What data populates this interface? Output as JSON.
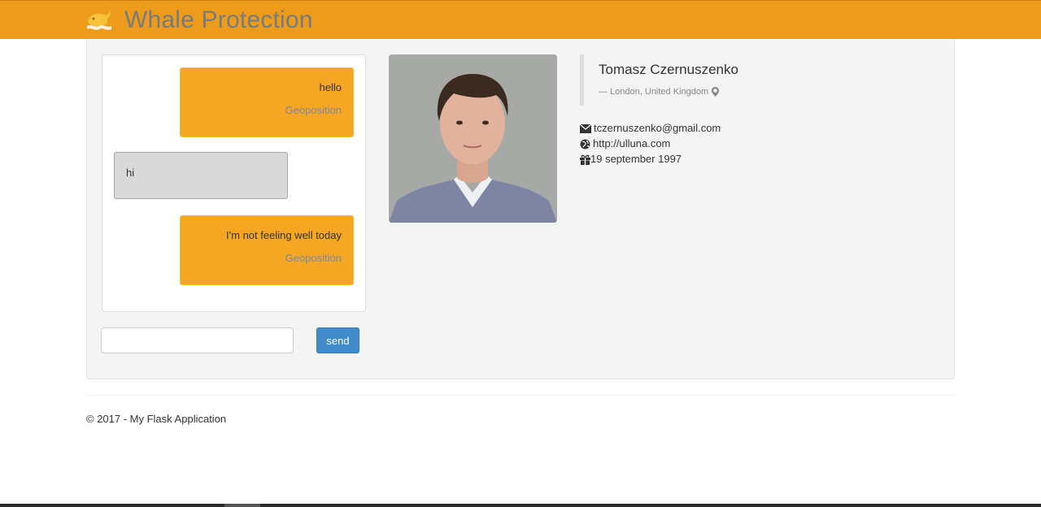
{
  "header": {
    "title": "Whale Protection",
    "logo_icon": "whale-logo-icon",
    "background": "#ec9c1a"
  },
  "chat": {
    "messages": [
      {
        "sender": "me",
        "text": "hello",
        "link": "Geoposition"
      },
      {
        "sender": "other",
        "text": "hi"
      },
      {
        "sender": "me",
        "text": "I'm not feeling well today",
        "link": "Geoposition"
      }
    ],
    "input": {
      "value": "",
      "placeholder": ""
    },
    "send_label": "send"
  },
  "profile": {
    "name": "Tomasz Czernuszenko",
    "location": "— London, United Kingdom",
    "location_icon": "map-marker-icon",
    "email": "tczernuszenko@gmail.com",
    "email_icon": "envelope-icon",
    "website": "http://ulluna.com",
    "website_icon": "globe-icon",
    "birthday": "19 september 1997",
    "birthday_icon": "gift-icon"
  },
  "footer": {
    "text": "© 2017 - My Flask Application"
  },
  "colors": {
    "accent": "#f5a623",
    "message_other": "#d9d9d9",
    "button": "#428bca",
    "link": "#7e8b9c"
  }
}
